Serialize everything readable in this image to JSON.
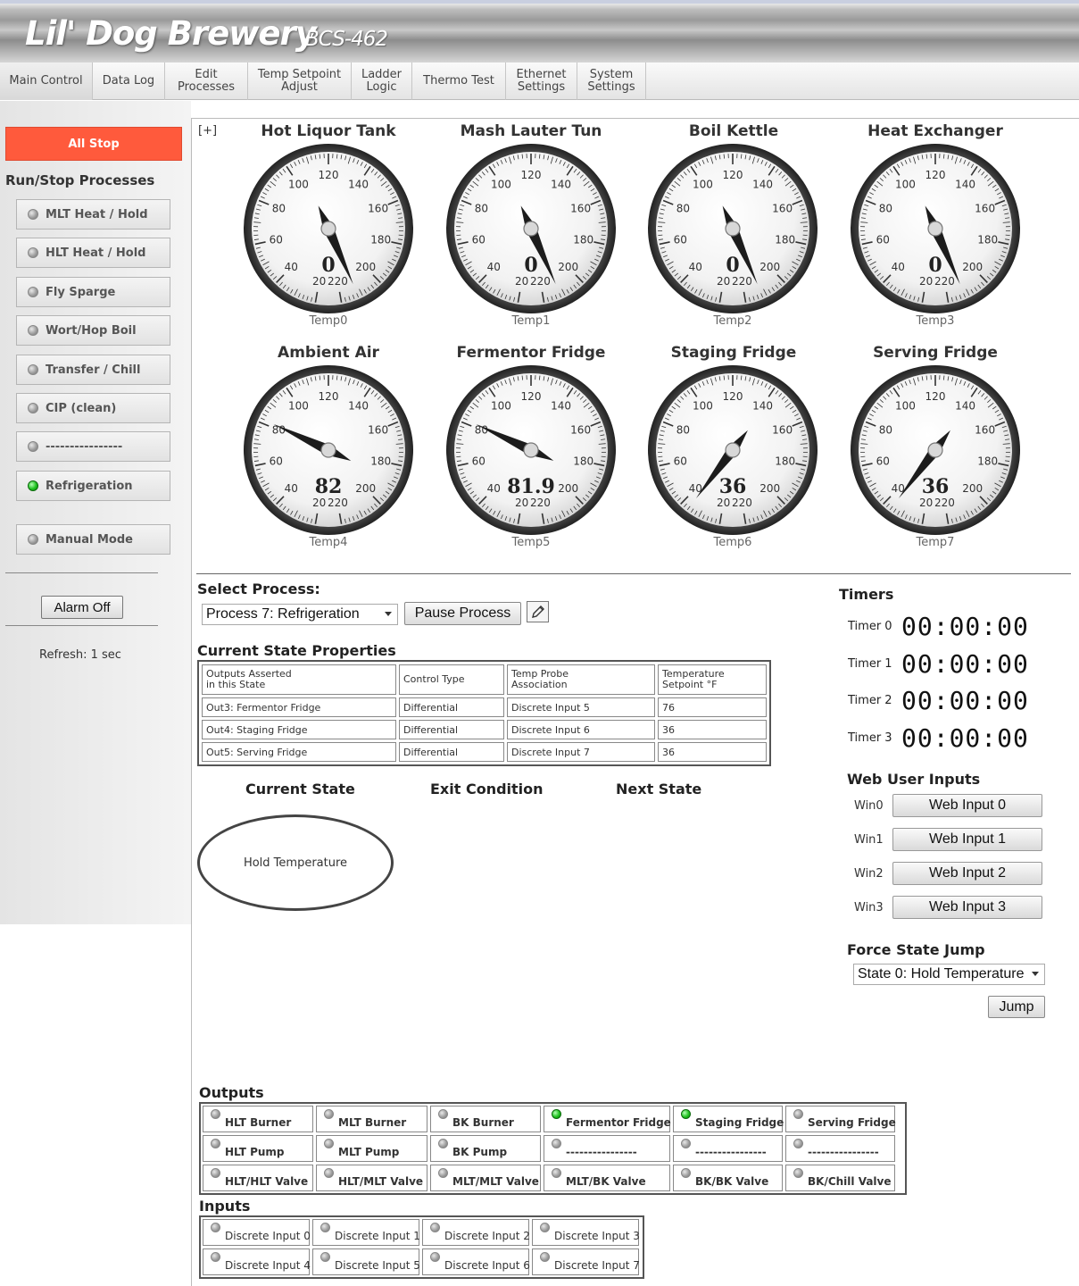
{
  "header": {
    "title": "Lil' Dog Brewery",
    "model": "BCS-462"
  },
  "nav": [
    {
      "label": "Main Control",
      "active": true
    },
    {
      "label": "Data Log"
    },
    {
      "label": "Edit\nProcesses"
    },
    {
      "label": "Temp Setpoint\nAdjust"
    },
    {
      "label": "Ladder\nLogic"
    },
    {
      "label": "Thermo Test"
    },
    {
      "label": "Ethernet\nSettings"
    },
    {
      "label": "System\nSettings"
    }
  ],
  "sidebar": {
    "all_stop": "All Stop",
    "heading": "Run/Stop Processes",
    "processes": [
      {
        "label": "MLT Heat / Hold",
        "on": false
      },
      {
        "label": "HLT Heat / Hold",
        "on": false
      },
      {
        "label": "Fly Sparge",
        "on": false
      },
      {
        "label": "Wort/Hop Boil",
        "on": false
      },
      {
        "label": "Transfer / Chill",
        "on": false
      },
      {
        "label": "CIP (clean)",
        "on": false
      },
      {
        "label": "----------------",
        "on": false
      },
      {
        "label": "Refrigeration",
        "on": true
      },
      {
        "label": "Manual Mode",
        "on": false
      }
    ],
    "alarm_off": "Alarm Off",
    "refresh": "Refresh:  1 sec"
  },
  "expand_label": "[+]",
  "gauges": [
    {
      "title": "Hot Liquor Tank",
      "value": 0,
      "display": "0",
      "probe": "Temp0"
    },
    {
      "title": "Mash Lauter Tun",
      "value": 0,
      "display": "0",
      "probe": "Temp1"
    },
    {
      "title": "Boil Kettle",
      "value": 0,
      "display": "0",
      "probe": "Temp2"
    },
    {
      "title": "Heat Exchanger",
      "value": 0,
      "display": "0",
      "probe": "Temp3"
    },
    {
      "title": "Ambient Air",
      "value": 82,
      "display": "82",
      "probe": "Temp4"
    },
    {
      "title": "Fermentor Fridge",
      "value": 81.9,
      "display": "81.9",
      "probe": "Temp5"
    },
    {
      "title": "Staging Fridge",
      "value": 36,
      "display": "36",
      "probe": "Temp6"
    },
    {
      "title": "Serving Fridge",
      "value": 36,
      "display": "36",
      "probe": "Temp7"
    }
  ],
  "gauge_scale": {
    "min": 20,
    "max": 220,
    "labels": [
      "20",
      "40",
      "60",
      "80",
      "100",
      "120",
      "140",
      "160",
      "180",
      "200",
      "220"
    ]
  },
  "process": {
    "select_label": "Select Process:",
    "selected": "Process 7: Refrigeration",
    "pause_label": "Pause Process"
  },
  "state_props": {
    "title": "Current State Properties",
    "headers": [
      "Outputs Asserted\nin this State",
      "Control Type",
      "Temp Probe\nAssociation",
      "Temperature\nSetpoint °F"
    ],
    "rows": [
      [
        "Out3: Fermentor Fridge",
        "Differential",
        "Discrete Input 5",
        "76"
      ],
      [
        "Out4: Staging Fridge",
        "Differential",
        "Discrete Input 6",
        "36"
      ],
      [
        "Out5: Serving Fridge",
        "Differential",
        "Discrete Input 7",
        "36"
      ]
    ]
  },
  "state_flow": {
    "current_label": "Current State",
    "exit_label": "Exit Condition",
    "next_label": "Next State",
    "current_state": "Hold Temperature"
  },
  "timers": {
    "title": "Timers",
    "items": [
      {
        "label": "Timer 0",
        "value": "00:00:00"
      },
      {
        "label": "Timer 1",
        "value": "00:00:00"
      },
      {
        "label": "Timer 2",
        "value": "00:00:00"
      },
      {
        "label": "Timer 3",
        "value": "00:00:00"
      }
    ]
  },
  "web_inputs": {
    "title": "Web User Inputs",
    "items": [
      {
        "label": "Win0",
        "button": "Web Input 0"
      },
      {
        "label": "Win1",
        "button": "Web Input 1"
      },
      {
        "label": "Win2",
        "button": "Web Input 2"
      },
      {
        "label": "Win3",
        "button": "Web Input 3"
      }
    ]
  },
  "force_jump": {
    "title": "Force State Jump",
    "selected": "State 0: Hold Temperature",
    "button": "Jump"
  },
  "outputs": {
    "title": "Outputs",
    "cells": [
      {
        "label": "HLT Burner",
        "on": false
      },
      {
        "label": "MLT Burner",
        "on": false
      },
      {
        "label": "BK Burner",
        "on": false
      },
      {
        "label": "Fermentor Fridge",
        "on": true
      },
      {
        "label": "Staging Fridge",
        "on": true
      },
      {
        "label": "Serving Fridge",
        "on": false
      },
      {
        "label": "HLT Pump",
        "on": false
      },
      {
        "label": "MLT Pump",
        "on": false
      },
      {
        "label": "BK Pump",
        "on": false
      },
      {
        "label": "----------------",
        "on": false
      },
      {
        "label": "----------------",
        "on": false
      },
      {
        "label": "----------------",
        "on": false
      },
      {
        "label": "HLT/HLT Valve",
        "on": false
      },
      {
        "label": "HLT/MLT Valve",
        "on": false
      },
      {
        "label": "MLT/MLT Valve",
        "on": false
      },
      {
        "label": "MLT/BK Valve",
        "on": false
      },
      {
        "label": "BK/BK Valve",
        "on": false
      },
      {
        "label": "BK/Chill Valve",
        "on": false
      }
    ]
  },
  "inputs": {
    "title": "Inputs",
    "cells": [
      {
        "label": "Discrete Input 0"
      },
      {
        "label": "Discrete Input 1"
      },
      {
        "label": "Discrete Input 2"
      },
      {
        "label": "Discrete Input 3"
      },
      {
        "label": "Discrete Input 4"
      },
      {
        "label": "Discrete Input 5"
      },
      {
        "label": "Discrete Input 6"
      },
      {
        "label": "Discrete Input 7"
      }
    ]
  }
}
